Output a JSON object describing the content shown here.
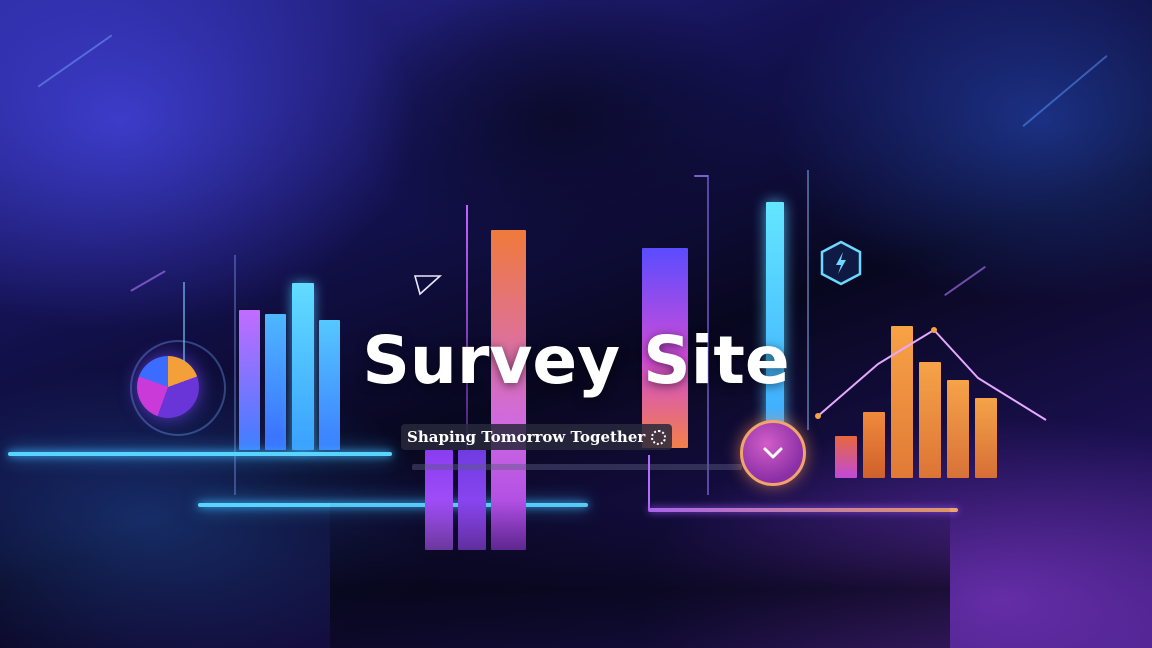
{
  "hero": {
    "title": "Survey Site",
    "tagline": "Shaping Tomorrow Together"
  },
  "icons": {
    "tagline_icon": "loading-spinner-icon",
    "scroll_button_icon": "chevron-down-icon",
    "hex_badge_icon": "bolt-icon",
    "triangle_icon": "triangle-cursor-icon"
  },
  "colors": {
    "title": "#ffffff",
    "accent_cyan": "#59d4ff",
    "accent_orange": "#f4a03a",
    "accent_purple": "#b86cff"
  }
}
